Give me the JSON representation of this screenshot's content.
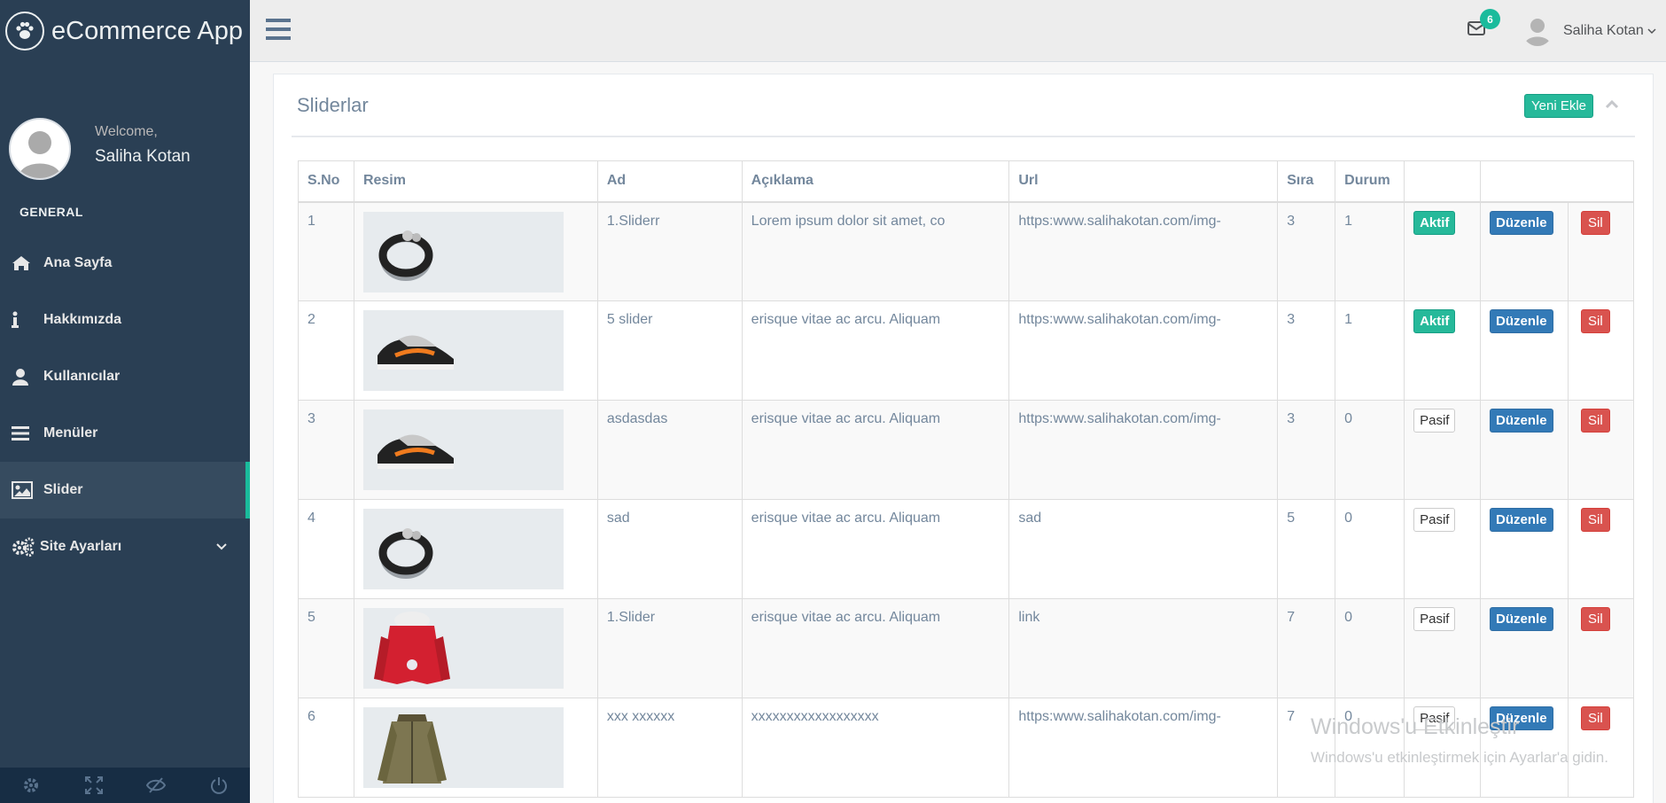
{
  "app": {
    "title": "eCommerce App"
  },
  "profile": {
    "welcome": "Welcome,",
    "name": "Saliha Kotan"
  },
  "sidebar": {
    "section": "GENERAL",
    "items": [
      {
        "label": "Ana Sayfa",
        "icon": "home-icon"
      },
      {
        "label": "Hakkımızda",
        "icon": "info-icon"
      },
      {
        "label": "Kullanıcılar",
        "icon": "user-icon"
      },
      {
        "label": "Menüler",
        "icon": "bars-icon"
      },
      {
        "label": "Slider",
        "icon": "image-icon",
        "active": true
      },
      {
        "label": "Site Ayarları",
        "icon": "gears-icon"
      }
    ]
  },
  "topbar": {
    "mail_count": "6",
    "user_name": "Saliha Kotan"
  },
  "panel": {
    "title": "Sliderlar",
    "add_button": "Yeni Ekle"
  },
  "table": {
    "headers": [
      "S.No",
      "Resim",
      "Ad",
      "Açıklama",
      "Url",
      "Sıra",
      "Durum",
      "",
      ""
    ],
    "rows": [
      {
        "no": "1",
        "image": "ring",
        "ad": "1.Sliderr",
        "aciklama": "Lorem ipsum dolor sit amet, co",
        "url": "https:www.salihakotan.com/img-",
        "sira": "3",
        "durum": "1",
        "status": "Aktif",
        "edit": "Düzenle",
        "delete": "Sil"
      },
      {
        "no": "2",
        "image": "shoe",
        "ad": "5 slider",
        "aciklama": "erisque vitae ac arcu. Aliquam",
        "url": "https:www.salihakotan.com/img-",
        "sira": "3",
        "durum": "1",
        "status": "Aktif",
        "edit": "Düzenle",
        "delete": "Sil"
      },
      {
        "no": "3",
        "image": "shoe",
        "ad": "asdasdas",
        "aciklama": "erisque vitae ac arcu. Aliquam",
        "url": "https:www.salihakotan.com/img-",
        "sira": "3",
        "durum": "0",
        "status": "Pasif",
        "edit": "Düzenle",
        "delete": "Sil"
      },
      {
        "no": "4",
        "image": "ring",
        "ad": "sad",
        "aciklama": "erisque vitae ac arcu. Aliquam",
        "url": "sad",
        "sira": "5",
        "durum": "0",
        "status": "Pasif",
        "edit": "Düzenle",
        "delete": "Sil"
      },
      {
        "no": "5",
        "image": "red-jacket",
        "ad": "1.Slider",
        "aciklama": "erisque vitae ac arcu. Aliquam",
        "url": "link",
        "sira": "7",
        "durum": "0",
        "status": "Pasif",
        "edit": "Düzenle",
        "delete": "Sil"
      },
      {
        "no": "6",
        "image": "green-jacket",
        "ad": "xxx xxxxxx",
        "aciklama": "xxxxxxxxxxxxxxxxxx",
        "url": "https:www.salihakotan.com/img-",
        "sira": "7",
        "durum": "0",
        "status": "Pasif",
        "edit": "Düzenle",
        "delete": "Sil"
      }
    ]
  },
  "watermark": {
    "line1": "Windows'u Etkinleştir",
    "line2": "Windows'u etkinleştirmek için Ayarlar'a gidin."
  },
  "colors": {
    "sidebar": "#2A3F54",
    "accent": "#1ABB9C",
    "primary": "#337ab7",
    "danger": "#d9534f"
  }
}
